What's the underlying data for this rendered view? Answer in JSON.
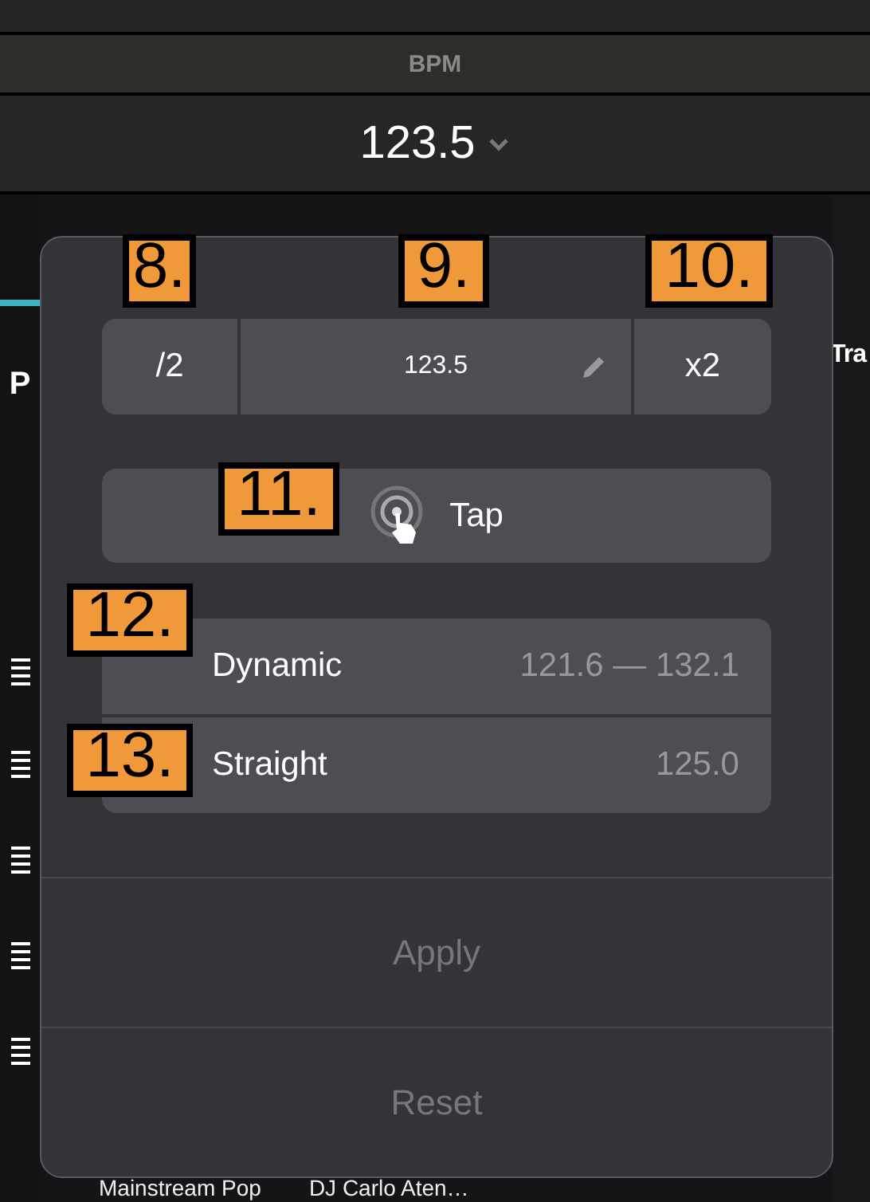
{
  "header": {
    "label": "BPM",
    "value": "123.5"
  },
  "background": {
    "left_initial": "P",
    "right_heading": "Tra",
    "track_title": "Mainstream Pop",
    "track_artist": "DJ Carlo Aten…"
  },
  "popup": {
    "halve": "/2",
    "bpm_value": "123.5",
    "double": "x2",
    "tap": "Tap",
    "options": [
      {
        "label": "Dynamic",
        "value": "121.6 — 132.1"
      },
      {
        "label": "Straight",
        "value": "125.0"
      }
    ],
    "actions": [
      {
        "label": "Apply",
        "disabled": true
      },
      {
        "label": "Reset",
        "disabled": true
      }
    ]
  },
  "callouts": [
    "8.",
    "9.",
    "10.",
    "11.",
    "12.",
    "13."
  ]
}
